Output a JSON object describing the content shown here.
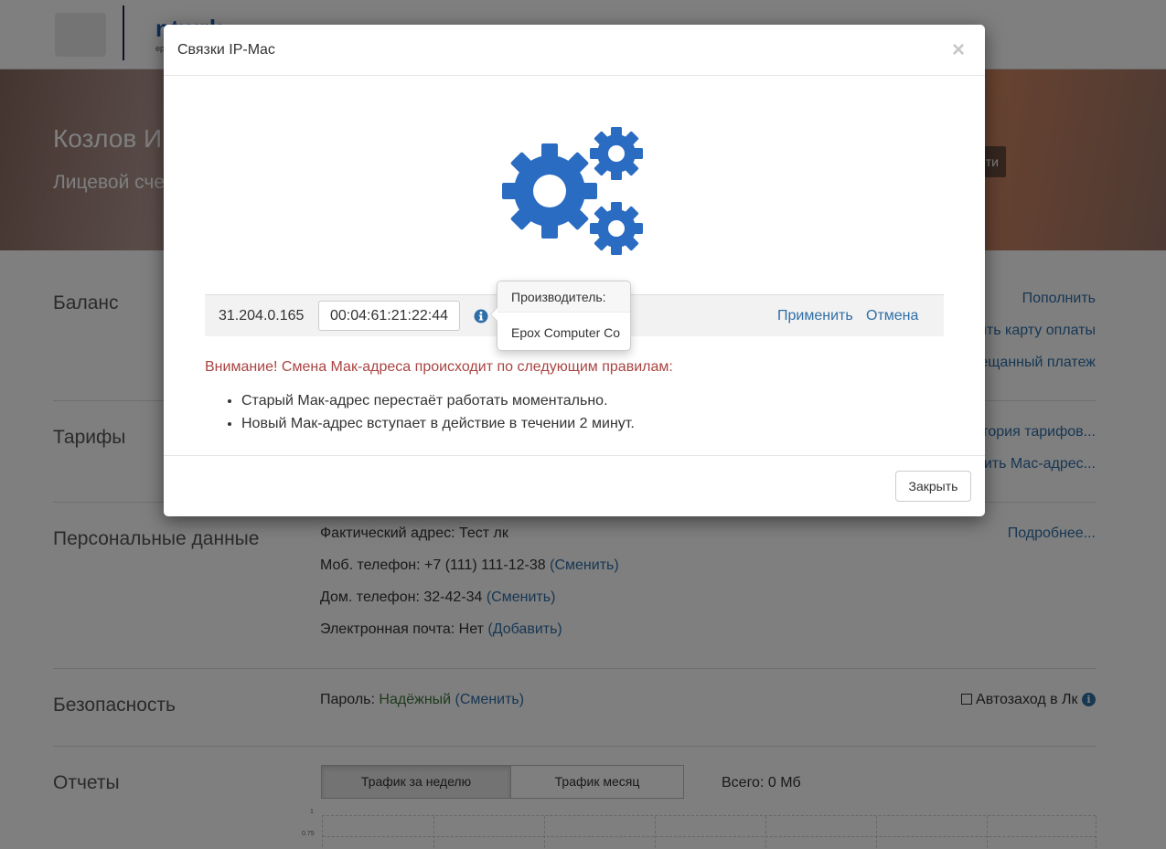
{
  "header": {
    "logo_text": "ntwrk",
    "logo_sub": "ep"
  },
  "hero": {
    "name": "Козлов Иг",
    "account": "Лицевой сче",
    "button_label": "ти"
  },
  "balance": {
    "title": "Баланс",
    "links": [
      "Пополнить",
      "ить карту оплаты",
      "ещанный платеж"
    ]
  },
  "tariffs": {
    "title": "Тарифы",
    "links": [
      "тория тарифов...",
      "ить Мас-адрес..."
    ]
  },
  "personal": {
    "title": "Персональные данные",
    "address": "Фактический адрес: Тест лк",
    "mobile": "Моб. телефон: +7 (111) 111-12-38",
    "mobile_link": "(Сменить)",
    "home": "Дом. телефон: 32-42-34",
    "home_link": "(Сменить)",
    "email": "Электронная почта: Нет",
    "email_link": "(Добавить)",
    "more_link": "Подробнее..."
  },
  "security": {
    "title": "Безопасность",
    "password_label": "Пароль:",
    "password_status": "Надёжный",
    "password_link": "(Сменить)",
    "autologin_label": "Автозаход в Лк"
  },
  "reports": {
    "title": "Отчеты",
    "tab_week": "Трафик за неделю",
    "tab_month": "Трафик месяц",
    "total": "Всего: 0 Мб",
    "tick_top": "1",
    "tick_second": "0.75"
  },
  "modal": {
    "title": "Связки IP-Mac",
    "close_symbol": "×",
    "ip": "31.204.0.165",
    "mac_value": "00:04:61:21:22:44",
    "apply_label": "Применить",
    "cancel_label": "Отмена",
    "popover_title": "Производитель:",
    "popover_body": "Epox Computer Co",
    "warning": "Внимание! Смена Мак-адреса происходит по следующим правилам:",
    "rules": [
      "Старый Мак-адрес перестаёт работать моментально.",
      "Новый Мак-адрес вступает в действие в течении 2 минут."
    ],
    "close_button": "Закрыть"
  },
  "colors": {
    "accent": "#2f6ea7",
    "warning": "#a94442",
    "success": "#3c763d",
    "gear": "#2a6cc2"
  },
  "icons": [
    "gears-icon",
    "info-icon",
    "close-icon",
    "checkbox-icon"
  ]
}
